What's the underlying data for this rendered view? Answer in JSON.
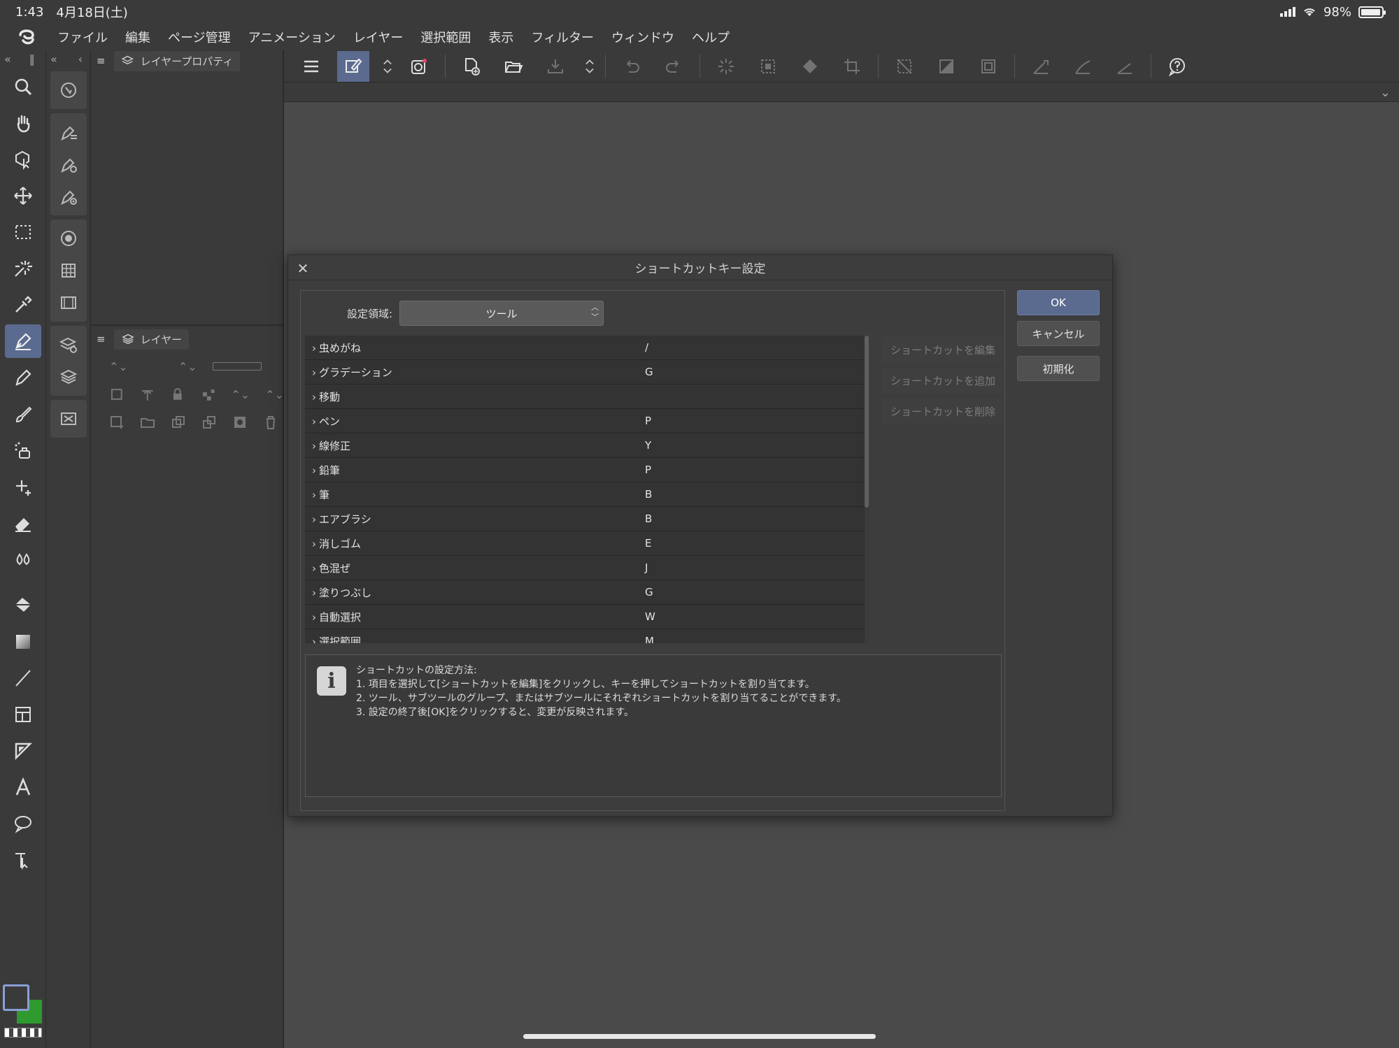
{
  "status": {
    "time": "1:43",
    "date": "4月18日(土)",
    "battery": "98%",
    "battery_level": 0.98
  },
  "menu": [
    "ファイル",
    "編集",
    "ページ管理",
    "アニメーション",
    "レイヤー",
    "選択範囲",
    "表示",
    "フィルター",
    "ウィンドウ",
    "ヘルプ"
  ],
  "palettes": {
    "layer_property_tab": "レイヤープロパティ",
    "layer_tab": "レイヤー"
  },
  "dialog": {
    "title": "ショートカットキー設定",
    "area_label": "設定領域:",
    "area_value": "ツール",
    "rows": [
      {
        "name": "虫めがね",
        "key": "/"
      },
      {
        "name": "グラデーション",
        "key": "G"
      },
      {
        "name": "移動",
        "key": ""
      },
      {
        "name": "ペン",
        "key": "P"
      },
      {
        "name": "線修正",
        "key": "Y"
      },
      {
        "name": "鉛筆",
        "key": "P"
      },
      {
        "name": "筆",
        "key": "B"
      },
      {
        "name": "エアブラシ",
        "key": "B"
      },
      {
        "name": "消しゴム",
        "key": "E"
      },
      {
        "name": "色混ぜ",
        "key": "J"
      },
      {
        "name": "塗りつぶし",
        "key": "G"
      },
      {
        "name": "自動選択",
        "key": "W"
      },
      {
        "name": "選択範囲",
        "key": "M"
      }
    ],
    "side_buttons": {
      "edit": "ショートカットを編集",
      "add": "ショートカットを追加",
      "delete": "ショートカットを削除"
    },
    "buttons": {
      "ok": "OK",
      "cancel": "キャンセル",
      "reset": "初期化"
    },
    "info": {
      "heading": "ショートカットの設定方法:",
      "line1": "1. 項目を選択して[ショートカットを編集]をクリックし、キーを押してショートカットを割り当てます。",
      "line2": "2. ツール、サブツールのグループ、またはサブツールにそれぞれショートカットを割り当てることができます。",
      "line3": "3. 設定の終了後[OK]をクリックすると、変更が反映されます。"
    }
  },
  "colors": {
    "accent": "#5b6b8f",
    "main_color_border": "#8a9fd6",
    "sub_color": "#2f9a2f"
  }
}
